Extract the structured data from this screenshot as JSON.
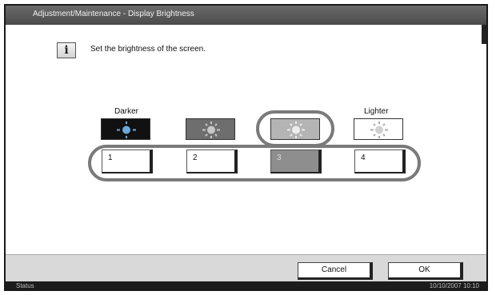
{
  "title": "Adjustment/Maintenance - Display Brightness",
  "message": "Set the brightness of the screen.",
  "levels": {
    "darker_label": "Darker",
    "lighter_label": "Lighter",
    "buttons": [
      "1",
      "2",
      "3",
      "4"
    ],
    "selected": "3"
  },
  "footer": {
    "cancel_label": "Cancel",
    "ok_label": "OK"
  },
  "statusbar": {
    "status_label": "Status",
    "datetime": "10/10/2007   10:10"
  },
  "icons": {
    "info": "info-icon",
    "brightness": "sun-icon"
  },
  "colors": {
    "title_bar": "#555555",
    "selected_button": "#8e8e8e",
    "highlight_oval": "#7a7a7a"
  }
}
